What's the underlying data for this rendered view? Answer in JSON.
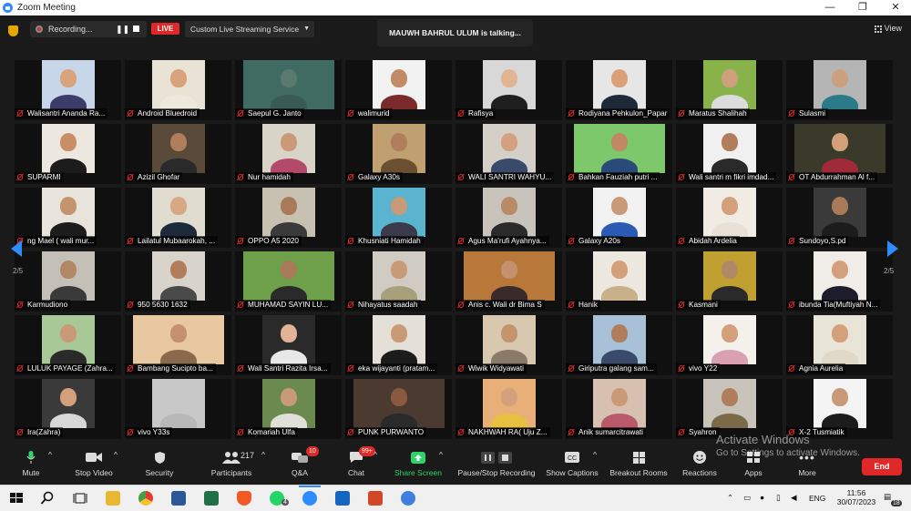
{
  "window": {
    "title": "Zoom Meeting",
    "controls": [
      "—",
      "❐",
      "✕"
    ]
  },
  "topbar": {
    "recording_label": "Recording...",
    "live_label": "LIVE",
    "stream_label": "Custom Live Streaming Service",
    "talking": "MAUWH BAHRUL ULUM is talking...",
    "view_label": "View"
  },
  "pager": {
    "left": "2/5",
    "right": "2/5"
  },
  "participants": [
    {
      "name": "Walisantri Ananda Ra...",
      "bg": "#c7d6e8",
      "skin": "#d9a47c",
      "cloth": "#3c3c6a"
    },
    {
      "name": "Android Bluedroid",
      "bg": "#e9e3d6",
      "skin": "#d7a27c",
      "cloth": "#ece8dc"
    },
    {
      "name": "Saepul G. Janto",
      "bg": "#3f6b63",
      "skin": "#5a7a70",
      "cloth": "#3a5a55"
    },
    {
      "name": "walimurid",
      "bg": "#f2f2f2",
      "skin": "#c28b66",
      "cloth": "#7a2a2a"
    },
    {
      "name": "Rafisya",
      "bg": "#d8d8d8",
      "skin": "#e2b592",
      "cloth": "#1f1f1f"
    },
    {
      "name": "Rodiyana Pehkulon_Papar",
      "bg": "#e6e6e6",
      "skin": "#d9a07a",
      "cloth": "#1e2a3a"
    },
    {
      "name": "Maratus Shalihah",
      "bg": "#88b24a",
      "skin": "#cfa07d",
      "cloth": "#dcdcdc"
    },
    {
      "name": "Sulasmi",
      "bg": "#b5b5b5",
      "skin": "#caa07e",
      "cloth": "#2a7a8a"
    },
    {
      "name": "SUPARMI",
      "bg": "#ece8e0",
      "skin": "#c98e68",
      "cloth": "#1c1c1c"
    },
    {
      "name": "Azizil Ghofar",
      "bg": "#5a4a3a",
      "skin": "#b07e5c",
      "cloth": "#2a2a2a"
    },
    {
      "name": "Nur hamidah",
      "bg": "#d8d4c8",
      "skin": "#c99a78",
      "cloth": "#b44a6a"
    },
    {
      "name": "Galaxy A30s",
      "bg": "#c0a070",
      "skin": "#b07e5c",
      "cloth": "#6a5030"
    },
    {
      "name": "WALI SANTRI WAHYU...",
      "bg": "#d4d0c8",
      "skin": "#d3a17f",
      "cloth": "#3a4a6a"
    },
    {
      "name": "Bahkan Fauziah putri ...",
      "bg": "#7cc86a",
      "skin": "#c08866",
      "cloth": "#2a4a7a"
    },
    {
      "name": "Wali santri m fikri imdad...",
      "bg": "#f0f0f0",
      "skin": "#b07e5c",
      "cloth": "#2a2a2a"
    },
    {
      "name": "OT Abdurrahman Al f...",
      "bg": "#3a3a2a",
      "skin": "#d4a07c",
      "cloth": "#a02a3a"
    },
    {
      "name": "ng Mael ( wali mur...",
      "bg": "#e8e4dc",
      "skin": "#c4946e",
      "cloth": "#1c1c1c"
    },
    {
      "name": "Lailatul Mubaarokah, ...",
      "bg": "#e0dcd0",
      "skin": "#d8a884",
      "cloth": "#1c2a3a"
    },
    {
      "name": "OPPO A5 2020",
      "bg": "#c8c0b0",
      "skin": "#a87a58",
      "cloth": "#3a3a3a"
    },
    {
      "name": "Khusniati Hamidah",
      "bg": "#5ab4d0",
      "skin": "#c99a78",
      "cloth": "#3a3a4a"
    },
    {
      "name": "Agus Ma'rufi Ayahnya...",
      "bg": "#c8c4bc",
      "skin": "#b88a66",
      "cloth": "#2a2a2a"
    },
    {
      "name": "Galaxy A20s",
      "bg": "#f2f2f2",
      "skin": "#c99a78",
      "cloth": "#2a5ab4"
    },
    {
      "name": "Abidah Ardelia",
      "bg": "#f0ece4",
      "skin": "#d4a07c",
      "cloth": "#e8e0d4"
    },
    {
      "name": "Sundoyo,S.pd",
      "bg": "#3a3a3a",
      "skin": "#a87a58",
      "cloth": "#1c1c1c"
    },
    {
      "name": "Karmudiono",
      "bg": "#c4c0b8",
      "skin": "#b08866",
      "cloth": "#3a3a3a"
    },
    {
      "name": "950 5630 1632",
      "bg": "#d8d4cc",
      "skin": "#b07e5c",
      "cloth": "#4a4a4a"
    },
    {
      "name": "MUHAMAD SAYIN LU...",
      "bg": "#6ea04a",
      "skin": "#a87a58",
      "cloth": "#2a2a2a"
    },
    {
      "name": "Nihayatus saadah",
      "bg": "#d0ccc4",
      "skin": "#c99a78",
      "cloth": "#a8a07a"
    },
    {
      "name": "Anis c. Wali dr Bima S",
      "bg": "#b8783a",
      "skin": "#c49070",
      "cloth": "#3a2a2a"
    },
    {
      "name": "Hanik",
      "bg": "#ece8e0",
      "skin": "#d4a07c",
      "cloth": "#c8b08a"
    },
    {
      "name": "Kasmani",
      "bg": "#c0a030",
      "skin": "#b08866",
      "cloth": "#2a2a2a"
    },
    {
      "name": "ibunda Tia(Muftiyah N...",
      "bg": "#f0ece8",
      "skin": "#d4a07c",
      "cloth": "#1c1c2a"
    },
    {
      "name": "LULUK PAYAGE (Zahra...",
      "bg": "#a8c898",
      "skin": "#c99a78",
      "cloth": "#2a2a2a"
    },
    {
      "name": "Bambang Sucipto ba...",
      "bg": "#e8c8a0",
      "skin": "#c49070",
      "cloth": "#8a6a4a"
    },
    {
      "name": "Wali Santri Razita Irsa...",
      "bg": "#2a2a2a",
      "skin": "#e0b494",
      "cloth": "#e8e8e8"
    },
    {
      "name": "eka wijayanti (pratam...",
      "bg": "#e4e0d8",
      "skin": "#c99a78",
      "cloth": "#1c1c1c"
    },
    {
      "name": "Wiwik Widyawati",
      "bg": "#d8c8b0",
      "skin": "#c4946e",
      "cloth": "#8a7a6a"
    },
    {
      "name": "Giriputra galang sam...",
      "bg": "#a8c0d8",
      "skin": "#b07e5c",
      "cloth": "#3a4a6a"
    },
    {
      "name": "vivo Y22",
      "bg": "#f4f0ec",
      "skin": "#d4a07c",
      "cloth": "#d8a0b0"
    },
    {
      "name": "Agnia Aurelia",
      "bg": "#e8e4d8",
      "skin": "#d4a07c",
      "cloth": "#e0d8c8"
    },
    {
      "name": "Ira(Zahra)",
      "bg": "#3a3a3a",
      "skin": "#d4a07c",
      "cloth": "#d8d8d8"
    },
    {
      "name": "vivo Y33s",
      "bg": "#c8c8c8",
      "skin": "#c8c8c8",
      "cloth": "#b8b8b8"
    },
    {
      "name": "Komariah Ulfa",
      "bg": "#6a8a50",
      "skin": "#c99a78",
      "cloth": "#e0e0d8"
    },
    {
      "name": "PUNK PURWANTO",
      "bg": "#4a3a30",
      "skin": "#8a5a40",
      "cloth": "#2a2a2a"
    },
    {
      "name": "NAKHWAH RA( Uju Z...",
      "bg": "#e8b078",
      "skin": "#d4a07c",
      "cloth": "#e8c040"
    },
    {
      "name": "Anik sumarcitrawati",
      "bg": "#d8c0b0",
      "skin": "#c99a78",
      "cloth": "#b85a6a"
    },
    {
      "name": "Syahron",
      "bg": "#c8c4bc",
      "skin": "#b07e5c",
      "cloth": "#7a6a4a"
    },
    {
      "name": "X-2 Tusmiatik",
      "bg": "#f4f4f4",
      "skin": "#c99a78",
      "cloth": "#1c1c1c"
    }
  ],
  "toolbar": {
    "mute": "Mute",
    "stop_video": "Stop Video",
    "security": "Security",
    "participants": "Participants",
    "participants_count": "217",
    "qa": "Q&A",
    "qa_badge": "10",
    "chat": "Chat",
    "chat_badge": "99+",
    "share_screen": "Share Screen",
    "pause_recording": "Pause/Stop Recording",
    "show_captions": "Show Captions",
    "breakout_rooms": "Breakout Rooms",
    "reactions": "Reactions",
    "apps": "Apps",
    "more": "More",
    "end": "End"
  },
  "watermark": {
    "line1": "Activate Windows",
    "line2": "Go to Settings to activate Windows."
  },
  "taskbar": {
    "language": "ENG",
    "time": "11:56",
    "date": "30/07/2023",
    "notif_count": "18",
    "whatsapp_count": "4"
  }
}
